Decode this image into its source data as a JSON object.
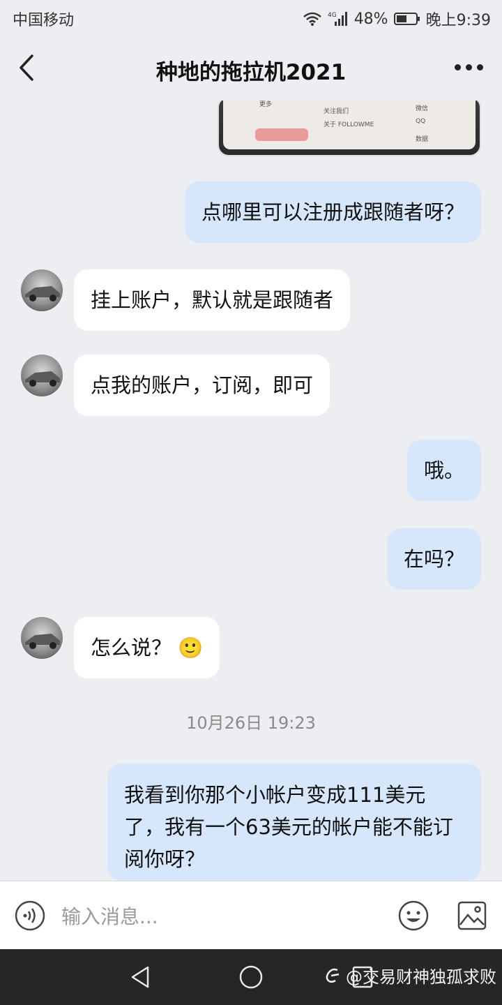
{
  "status_bar": {
    "carrier": "中国移动",
    "network": "4G",
    "battery": "48%",
    "time": "晚上9:39"
  },
  "header": {
    "title": "种地的拖拉机2021"
  },
  "image_message": {
    "lines": [
      "更多",
      "关注我们",
      "微信",
      "关于 FOLLOWME",
      "QQ",
      "数据"
    ]
  },
  "messages": [
    {
      "side": "out",
      "text": "点哪里可以注册成跟随者呀？"
    },
    {
      "side": "in",
      "text": "挂上账户，默认就是跟随者"
    },
    {
      "side": "in",
      "text": "点我的账户，订阅，即可"
    },
    {
      "side": "out",
      "text": "哦。"
    },
    {
      "side": "out",
      "text": "在吗？"
    },
    {
      "side": "in",
      "text": "怎么说？",
      "emoji": "🙂"
    },
    {
      "side": "out",
      "text": "我看到你那个小帐户变成111美元了，我有一个63美元的帐户能不能订阅你呀？"
    }
  ],
  "timestamp": "10月26日 19:23",
  "input": {
    "placeholder": "输入消息..."
  },
  "watermark": "@交易财神独孤求败",
  "colors": {
    "outgoing_bubble": "#d7e7fb",
    "incoming_bubble": "#ffffff",
    "background": "#edeef2",
    "nav_bar": "#262628"
  }
}
